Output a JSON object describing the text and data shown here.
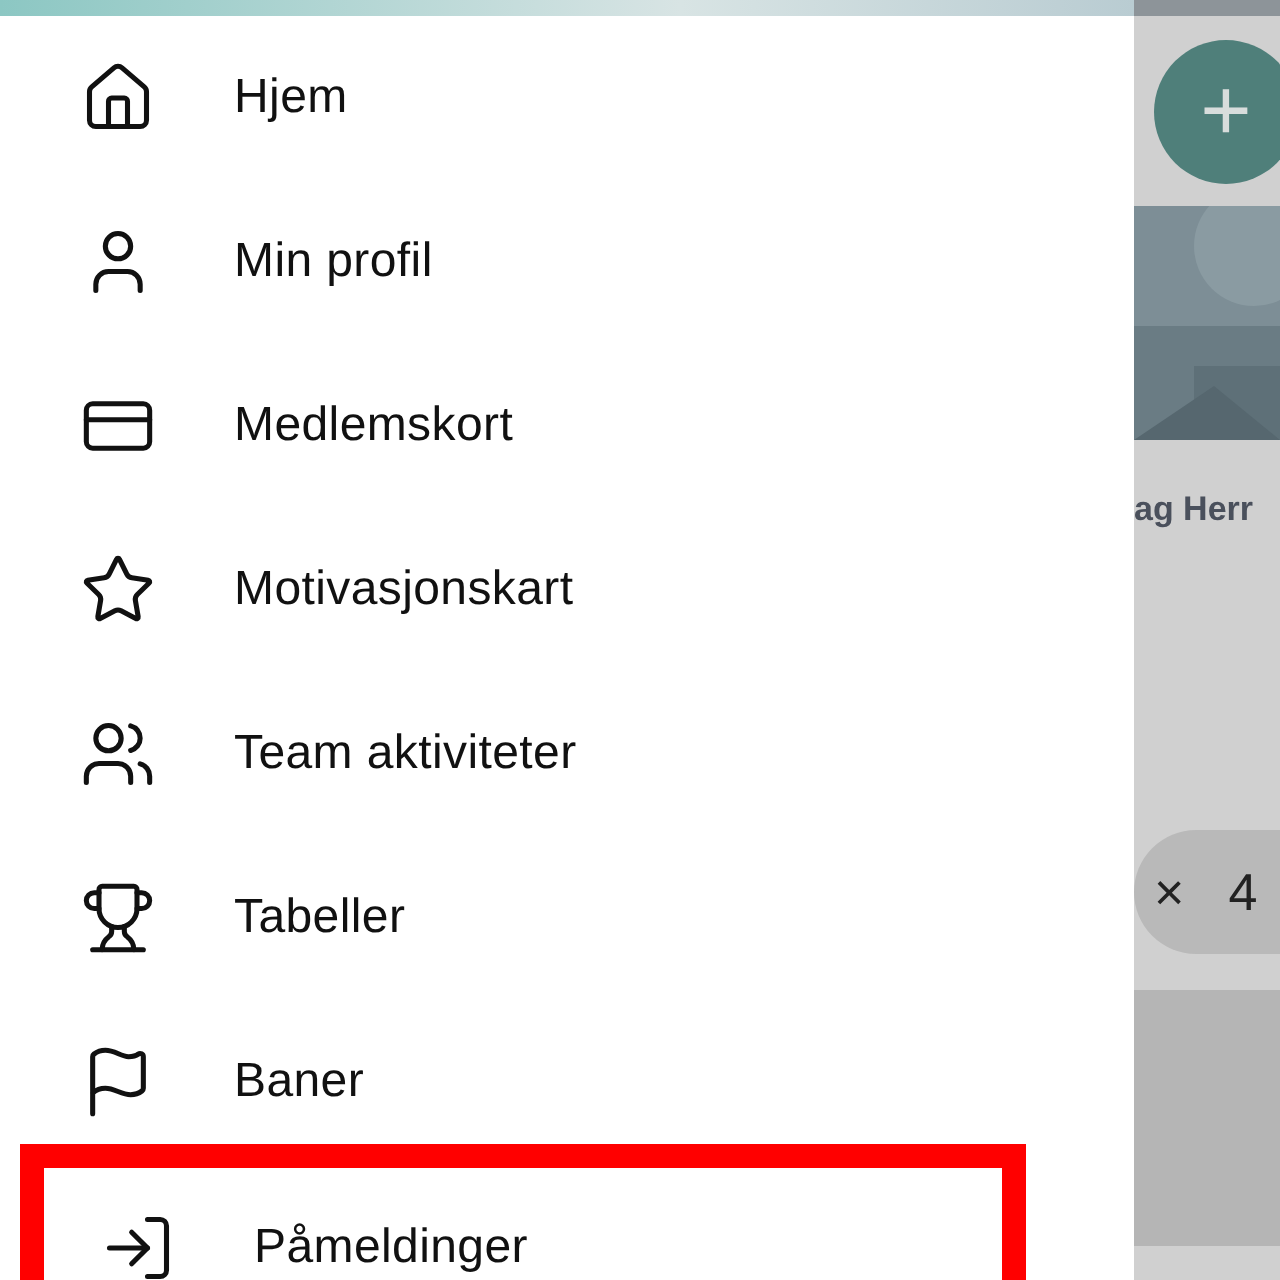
{
  "menu": {
    "items": [
      {
        "kind": "home",
        "label": "Hjem",
        "highlighted": false
      },
      {
        "kind": "user",
        "label": "Min profil",
        "highlighted": false
      },
      {
        "kind": "card",
        "label": "Medlemskort",
        "highlighted": false
      },
      {
        "kind": "star",
        "label": "Motivasjonskart",
        "highlighted": false
      },
      {
        "kind": "users",
        "label": "Team aktiviteter",
        "highlighted": false
      },
      {
        "kind": "trophy",
        "label": "Tabeller",
        "highlighted": false
      },
      {
        "kind": "flag",
        "label": "Baner",
        "highlighted": false
      },
      {
        "kind": "login",
        "label": "Påmeldinger",
        "highlighted": true
      }
    ]
  },
  "background": {
    "fab": "+",
    "card_title": "ag Herr",
    "chip": {
      "close": "×",
      "count": "4"
    }
  }
}
